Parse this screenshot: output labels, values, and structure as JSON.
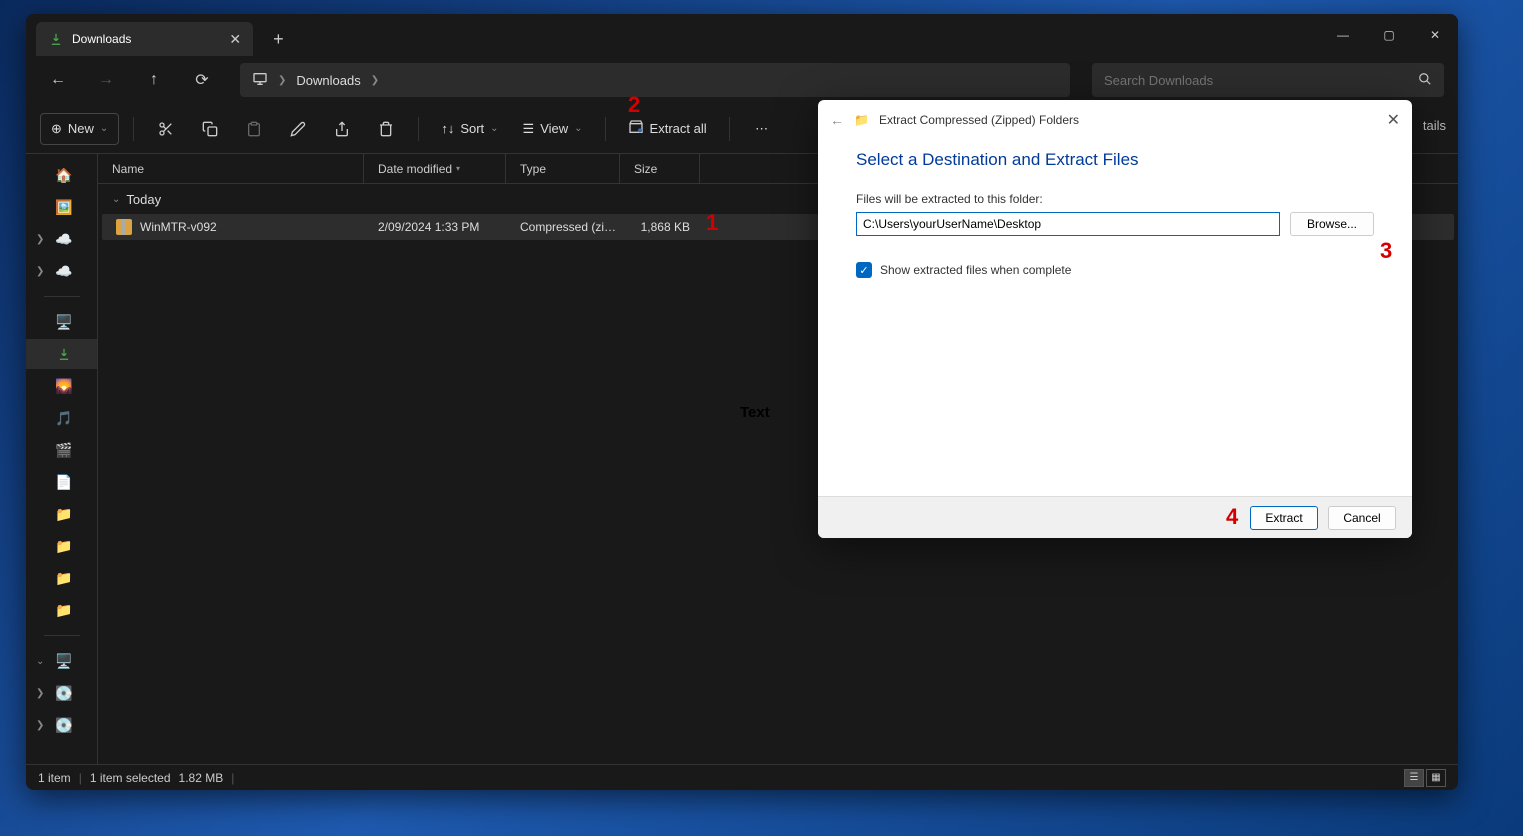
{
  "window": {
    "tab_title": "Downloads",
    "controls": {
      "min": "—",
      "max": "▢",
      "close": "✕"
    }
  },
  "nav": {
    "breadcrumb": "Downloads"
  },
  "search": {
    "placeholder": "Search Downloads"
  },
  "toolbar": {
    "new": "New",
    "sort": "Sort",
    "view": "View",
    "extract_all": "Extract all",
    "details_cut": "tails"
  },
  "columns": {
    "name": "Name",
    "date": "Date modified",
    "type": "Type",
    "size": "Size"
  },
  "group": "Today",
  "file": {
    "name": "WinMTR-v092",
    "date": "2/09/2024 1:33 PM",
    "type": "Compressed (zipp…",
    "size": "1,868 KB"
  },
  "status": {
    "count": "1 item",
    "selected": "1 item selected",
    "size": "1.82 MB"
  },
  "dialog": {
    "header": "Extract Compressed (Zipped) Folders",
    "title": "Select a Destination and Extract Files",
    "label": "Files will be extracted to this folder:",
    "path": "C:\\Users\\yourUserName\\Desktop",
    "browse": "Browse...",
    "show_files": "Show extracted files when complete",
    "extract": "Extract",
    "cancel": "Cancel"
  },
  "annotations": {
    "a1": "1",
    "a2": "2",
    "a3": "3",
    "a4": "4",
    "stray": "Text"
  }
}
